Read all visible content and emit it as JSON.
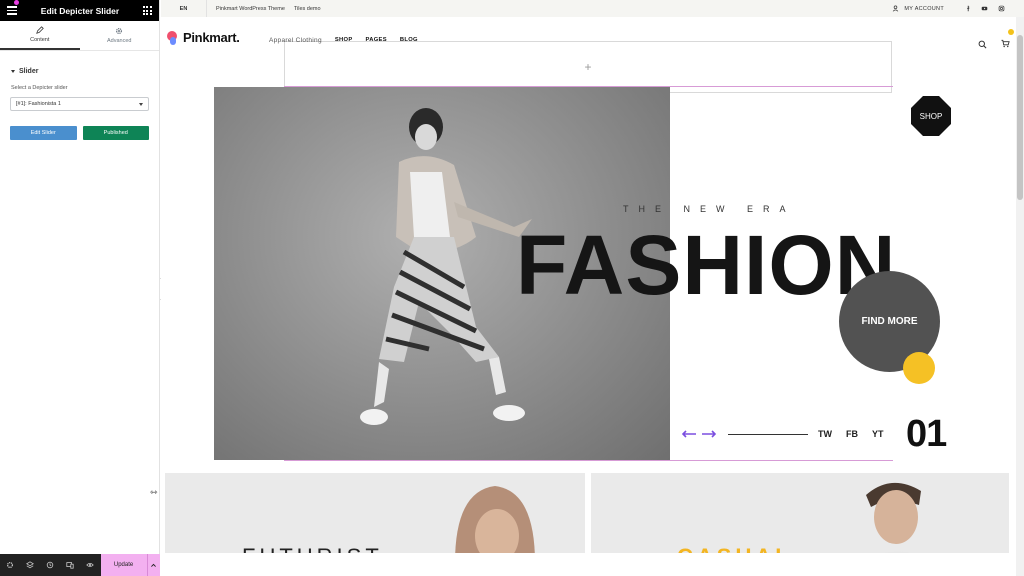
{
  "editor": {
    "title": "Edit Depicter Slider",
    "tabs": [
      {
        "label": "Content",
        "icon": "pencil-icon",
        "active": true
      },
      {
        "label": "Advanced",
        "icon": "gear-icon",
        "active": false
      }
    ],
    "section_title": "Slider",
    "select_label": "Select a Depicter slider",
    "select_value": "[#1]: Fashionista 1",
    "edit_button": "Edit Slider",
    "published_button": "Published",
    "footer": {
      "icons": [
        "settings-icon",
        "layers-icon",
        "history-icon",
        "responsive-icon",
        "preview-eye-icon"
      ],
      "update_label": "Update"
    },
    "colors": {
      "header": "#000000",
      "edit": "#4a8fce",
      "published": "#0e8456",
      "update": "#f3b0f0"
    }
  },
  "site": {
    "topbar": {
      "lang": "EN",
      "links": [
        "Pinkmart WordPress Theme",
        "Tiles demo"
      ],
      "account": "MY ACCOUNT",
      "social_icons": [
        "facebook-icon",
        "youtube-icon",
        "instagram-icon"
      ]
    },
    "logo": "Pinkmart.",
    "nav": {
      "tagline": "Apparel Clothing",
      "items": [
        "SHOP",
        "PAGES",
        "BLOG"
      ]
    },
    "dropzone_symbol": "+",
    "hero": {
      "eyebrow": "THE NEW ERA",
      "headline": "FASHION",
      "cta": "FIND MORE",
      "badge": "SHOP",
      "socials": [
        "TW",
        "FB",
        "YT"
      ],
      "slide_number": "01"
    },
    "tiles": [
      {
        "text": "FUTURIST"
      },
      {
        "text": "CASUAL"
      }
    ],
    "colors": {
      "accent_yellow": "#f5c125",
      "arrow_purple": "#7b4fe0",
      "line_pink": "#d79bd6"
    }
  }
}
